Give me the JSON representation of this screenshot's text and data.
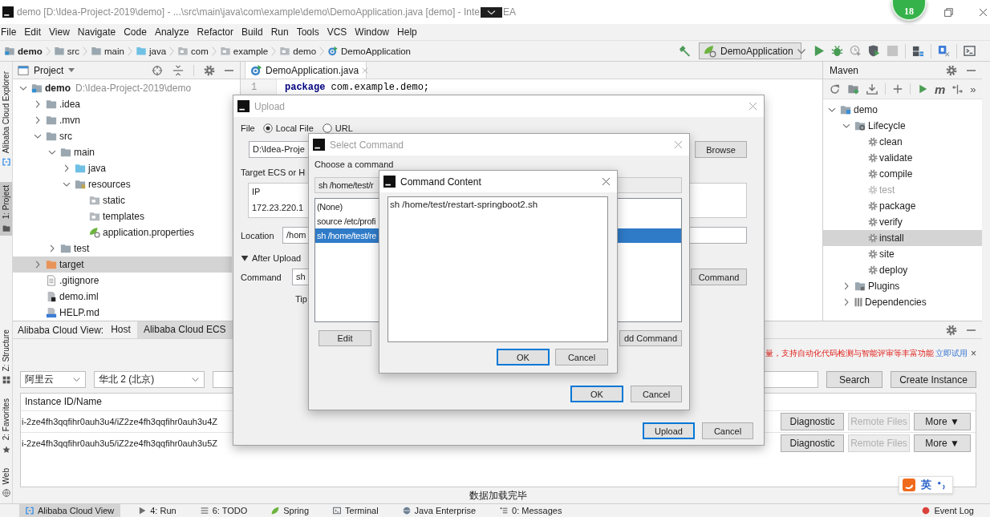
{
  "window": {
    "title": "demo [D:\\Idea-Project-2019\\demo] - ...\\src\\main\\java\\com\\example\\demo\\DemoApplication.java [demo] - Inte",
    "title_tail": "EA",
    "floating_badge": "18"
  },
  "menu": [
    "File",
    "Edit",
    "View",
    "Navigate",
    "Code",
    "Analyze",
    "Refactor",
    "Build",
    "Run",
    "Tools",
    "VCS",
    "Window",
    "Help"
  ],
  "breadcrumbs": [
    {
      "label": "demo",
      "kind": "module"
    },
    {
      "label": "src",
      "kind": "folder"
    },
    {
      "label": "main",
      "kind": "folder"
    },
    {
      "label": "java",
      "kind": "source"
    },
    {
      "label": "com",
      "kind": "package"
    },
    {
      "label": "example",
      "kind": "package"
    },
    {
      "label": "demo",
      "kind": "package"
    },
    {
      "label": "DemoApplication",
      "kind": "class"
    }
  ],
  "run_configuration": "DemoApplication",
  "left_tool_strip": [
    {
      "label": "Alibaba Cloud Explorer",
      "kind": "cloud",
      "selected": false
    },
    {
      "label": "1: Project",
      "kind": "project",
      "selected": true
    }
  ],
  "left_tool_strip_bottom": [
    {
      "label": "Z: Structure",
      "kind": "structure"
    },
    {
      "label": "2: Favorites",
      "kind": "favorites"
    },
    {
      "label": "Web",
      "kind": "web"
    }
  ],
  "project": {
    "title": "Project",
    "tree": [
      {
        "label": "demo",
        "path": "D:\\Idea-Project-2019\\demo",
        "kind": "module",
        "expanded": true,
        "selected": false,
        "children": [
          {
            "label": ".idea",
            "kind": "folder",
            "expanded": false,
            "selected": false
          },
          {
            "label": ".mvn",
            "kind": "folder",
            "expanded": false,
            "selected": false
          },
          {
            "label": "src",
            "kind": "folder",
            "expanded": true,
            "selected": false,
            "children": [
              {
                "label": "main",
                "kind": "folder",
                "expanded": true,
                "selected": false,
                "children": [
                  {
                    "label": "java",
                    "kind": "source_folder",
                    "expanded": false,
                    "selected": false
                  },
                  {
                    "label": "resources",
                    "kind": "resources_folder",
                    "expanded": true,
                    "selected": false,
                    "children": [
                      {
                        "label": "static",
                        "kind": "plain_folder",
                        "selected": false
                      },
                      {
                        "label": "templates",
                        "kind": "plain_folder",
                        "selected": false
                      },
                      {
                        "label": "application.properties",
                        "kind": "spring_config",
                        "selected": false
                      }
                    ]
                  }
                ]
              },
              {
                "label": "test",
                "kind": "folder",
                "expanded": false,
                "selected": false
              }
            ]
          },
          {
            "label": "target",
            "kind": "excluded_folder",
            "expanded": false,
            "selected": true
          },
          {
            "label": ".gitignore",
            "kind": "text_file",
            "selected": false
          },
          {
            "label": "demo.iml",
            "kind": "iml_file",
            "selected": false
          },
          {
            "label": "HELP.md",
            "kind": "markdown_file",
            "selected": false
          }
        ]
      }
    ]
  },
  "editor": {
    "tab": {
      "label": "DemoApplication.java",
      "selected": true
    },
    "lines": [
      {
        "number": "1",
        "tokens": [
          {
            "text": "package",
            "kind": "keyword"
          },
          {
            "text": " com.example.demo;",
            "kind": "plain"
          }
        ]
      }
    ]
  },
  "maven": {
    "title": "Maven",
    "goal_glyph": "m",
    "overflow_glyph": "»",
    "tree": [
      {
        "label": "demo",
        "kind": "project",
        "expanded": true,
        "selected": false,
        "children": [
          {
            "label": "Lifecycle",
            "kind": "lifecycle",
            "expanded": true,
            "selected": false,
            "children": [
              {
                "label": "clean",
                "kind": "goal",
                "skipped": false,
                "selected": false
              },
              {
                "label": "validate",
                "kind": "goal",
                "skipped": false,
                "selected": false
              },
              {
                "label": "compile",
                "kind": "goal",
                "skipped": false,
                "selected": false
              },
              {
                "label": "test",
                "kind": "goal",
                "skipped": true,
                "selected": false
              },
              {
                "label": "package",
                "kind": "goal",
                "skipped": false,
                "selected": false
              },
              {
                "label": "verify",
                "kind": "goal",
                "skipped": false,
                "selected": false
              },
              {
                "label": "install",
                "kind": "goal",
                "skipped": false,
                "selected": true
              },
              {
                "label": "site",
                "kind": "goal",
                "skipped": false,
                "selected": false
              },
              {
                "label": "deploy",
                "kind": "goal",
                "skipped": false,
                "selected": false
              }
            ]
          },
          {
            "label": "Plugins",
            "kind": "plugins",
            "expanded": false,
            "selected": false
          },
          {
            "label": "Dependencies",
            "kind": "dependencies",
            "expanded": false,
            "selected": false
          }
        ]
      }
    ]
  },
  "cloud_view": {
    "title": "Alibaba Cloud View:",
    "tabs": [
      {
        "label": "Host",
        "selected": false
      },
      {
        "label": "Alibaba Cloud ECS",
        "selected": true
      }
    ],
    "notice": {
      "text": "量，支持自动化代码检测与智能评审等丰富功能",
      "link": "立即试用",
      "close": "×"
    },
    "filters": [
      {
        "kind": "combo",
        "value": "阿里云"
      },
      {
        "kind": "combo",
        "value": "华北 2 (北京)"
      },
      {
        "kind": "search"
      }
    ],
    "buttons": [
      "Search",
      "Create Instance"
    ],
    "table": {
      "columns": [
        "Instance ID/Name"
      ],
      "rows": [
        {
          "cells": [
            "i-2ze4fh3qqfihr0auh3u4/iZ2ze4fh3qqfihr0auh3u4Z"
          ],
          "actions": [
            {
              "label": "Diagnostic",
              "disabled": false
            },
            {
              "label": "Remote Files",
              "disabled": true
            },
            {
              "label": "More ▼",
              "disabled": false
            }
          ]
        },
        {
          "cells": [
            "i-2ze4fh3qqfihr0auh3u5/iZ2ze4fh3qqfihr0auh3u5Z"
          ],
          "actions": [
            {
              "label": "Diagnostic",
              "disabled": false
            },
            {
              "label": "Remote Files",
              "disabled": true
            },
            {
              "label": "More ▼",
              "disabled": false
            }
          ]
        }
      ]
    },
    "status": "数据加载完毕"
  },
  "bottom_tabs": [
    {
      "label": "Alibaba Cloud View",
      "kind": "cloud",
      "selected": true
    },
    {
      "label": "4: Run",
      "kind": "run",
      "selected": false
    },
    {
      "label": "6: TODO",
      "kind": "todo",
      "selected": false
    },
    {
      "label": "Spring",
      "kind": "spring",
      "selected": false
    },
    {
      "label": "Terminal",
      "kind": "terminal",
      "selected": false
    },
    {
      "label": "Java Enterprise",
      "kind": "javaee",
      "selected": false
    },
    {
      "label": "0: Messages",
      "kind": "messages",
      "selected": false
    }
  ],
  "event_log": {
    "label": "Event Log",
    "kind": "event"
  },
  "upload_dialog": {
    "title": "Upload",
    "active": false,
    "file_label": "File",
    "sources": [
      {
        "label": "Local File",
        "selected": true
      },
      {
        "label": "URL",
        "selected": false
      }
    ],
    "path": "D:\\Idea-Proje",
    "browse": "Browse",
    "target_label": "Target ECS or H",
    "hosts": {
      "columns": [
        "IP"
      ],
      "rows": [
        "172.23.220.1"
      ]
    },
    "location_label": "Location",
    "location": "/hom",
    "after_upload": {
      "label": "After Upload",
      "expanded": true
    },
    "command_label": "Command",
    "command": "sh",
    "command_button": "Command",
    "tip": "Tip",
    "buttons": [
      {
        "label": "Upload",
        "default": true
      },
      {
        "label": "Cancel",
        "default": false
      }
    ]
  },
  "select_command_dialog": {
    "title": "Select Command",
    "active": false,
    "label": "Choose a command",
    "current": "sh /home/test/r",
    "commands": [
      {
        "label": "(None)",
        "selected": false
      },
      {
        "label": "source /etc/profi",
        "selected": false
      },
      {
        "label": "sh /home/test/re",
        "selected": true
      }
    ],
    "edit_button": "Edit",
    "add_button": "dd Command",
    "buttons": [
      {
        "label": "OK",
        "default": true
      },
      {
        "label": "Cancel",
        "default": false
      }
    ]
  },
  "command_content_dialog": {
    "title": "Command Content",
    "active": true,
    "content": "sh /home/test/restart-springboot2.sh",
    "buttons": [
      {
        "label": "OK",
        "default": true
      },
      {
        "label": "Cancel",
        "default": false
      }
    ]
  },
  "ime_bar": {
    "mode": "英"
  }
}
